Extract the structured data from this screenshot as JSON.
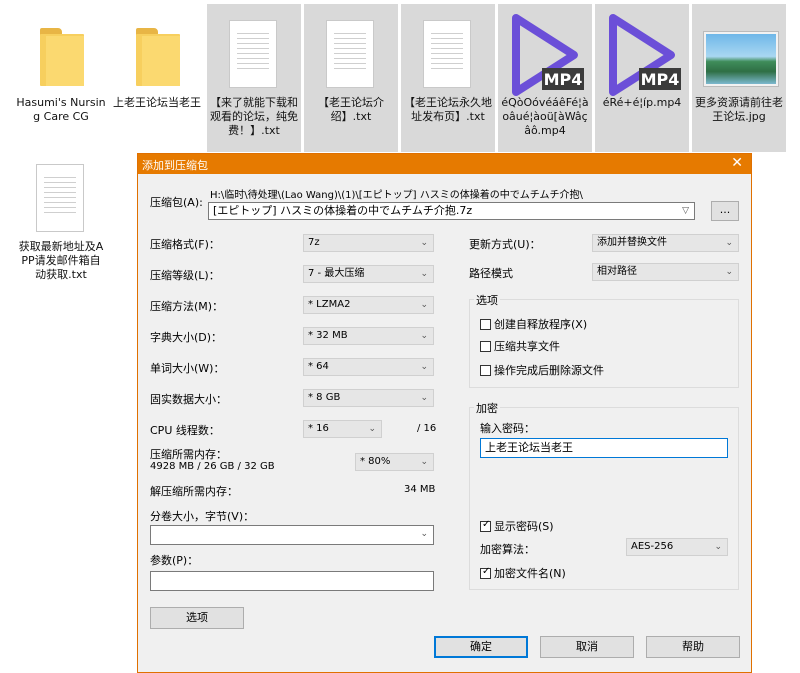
{
  "explorer": {
    "files": [
      {
        "name": "Hasumi's Nursing Care CG",
        "icon": "folder-icon"
      },
      {
        "name": "上老王论坛当老王",
        "icon": "folder-icon"
      },
      {
        "name": "【来了就能下载和观看的论坛，纯免费！】.txt",
        "icon": "text-file-icon"
      },
      {
        "name": "【老王论坛介绍】.txt",
        "icon": "text-file-icon"
      },
      {
        "name": "【老王论坛永久地址发布页】.txt",
        "icon": "text-file-icon"
      },
      {
        "name": "éQòOóvéáêFé¦àoâué¦àoü[àWâçâô.mp4",
        "icon": "mp4-icon",
        "badge": "MP4"
      },
      {
        "name": "éRé+é¦íp.mp4",
        "icon": "mp4-icon",
        "badge": "MP4"
      },
      {
        "name": "更多资源请前往老王论坛.jpg",
        "icon": "image-file-icon"
      },
      {
        "name": "获取最新地址及APP请发邮件箱自动获取.txt",
        "icon": "text-file-icon"
      }
    ]
  },
  "dialog": {
    "title": "添加到压缩包",
    "close": "✕",
    "archive_label": "压缩包(A):",
    "archive_path": "H:\\临时\\待处理\\(Lao Wang)\\(1)\\[エピトップ] ハスミの体操着の中でムチムチ介抱\\",
    "archive_name": "[エピトップ] ハスミの体操着の中でムチムチ介抱.7z",
    "browse": "...",
    "left": [
      {
        "label": "压缩格式(F)：",
        "value": "7z"
      },
      {
        "label": "压缩等级(L)：",
        "value": "7 - 最大压缩"
      },
      {
        "label": "压缩方法(M)：",
        "value": "* LZMA2"
      },
      {
        "label": "字典大小(D)：",
        "value": "* 32 MB"
      },
      {
        "label": "单词大小(W)：",
        "value": "* 64"
      },
      {
        "label": "固实数据大小：",
        "value": "* 8 GB"
      }
    ],
    "cpu_label": "CPU 线程数：",
    "cpu_value": "* 16",
    "cpu_total": "/ 16",
    "mem_label": "压缩所需内存：",
    "mem_detail": "4928 MB / 26 GB / 32 GB",
    "mem_value": "* 80%",
    "decomp_label": "解压缩所需内存：",
    "decomp_value": "34 MB",
    "split_label": "分卷大小，字节(V)：",
    "split_value": "",
    "params_label": "参数(P)：",
    "params_value": "",
    "options_btn": "选项",
    "update_label": "更新方式(U)：",
    "update_value": "添加并替换文件",
    "pathmode_label": "路径模式",
    "pathmode_value": "相对路径",
    "options_group": "选项",
    "opt_sfx": "创建自释放程序(X)",
    "opt_shared": "压缩共享文件",
    "opt_delete": "操作完成后删除源文件",
    "enc_group": "加密",
    "pwd_label": "输入密码：",
    "pwd_value": "上老王论坛当老王",
    "show_pwd": "显示密码(S)",
    "enc_method_label": "加密算法：",
    "enc_method_value": "AES-256",
    "enc_names": "加密文件名(N)",
    "ok": "确定",
    "cancel": "取消",
    "help": "帮助"
  }
}
